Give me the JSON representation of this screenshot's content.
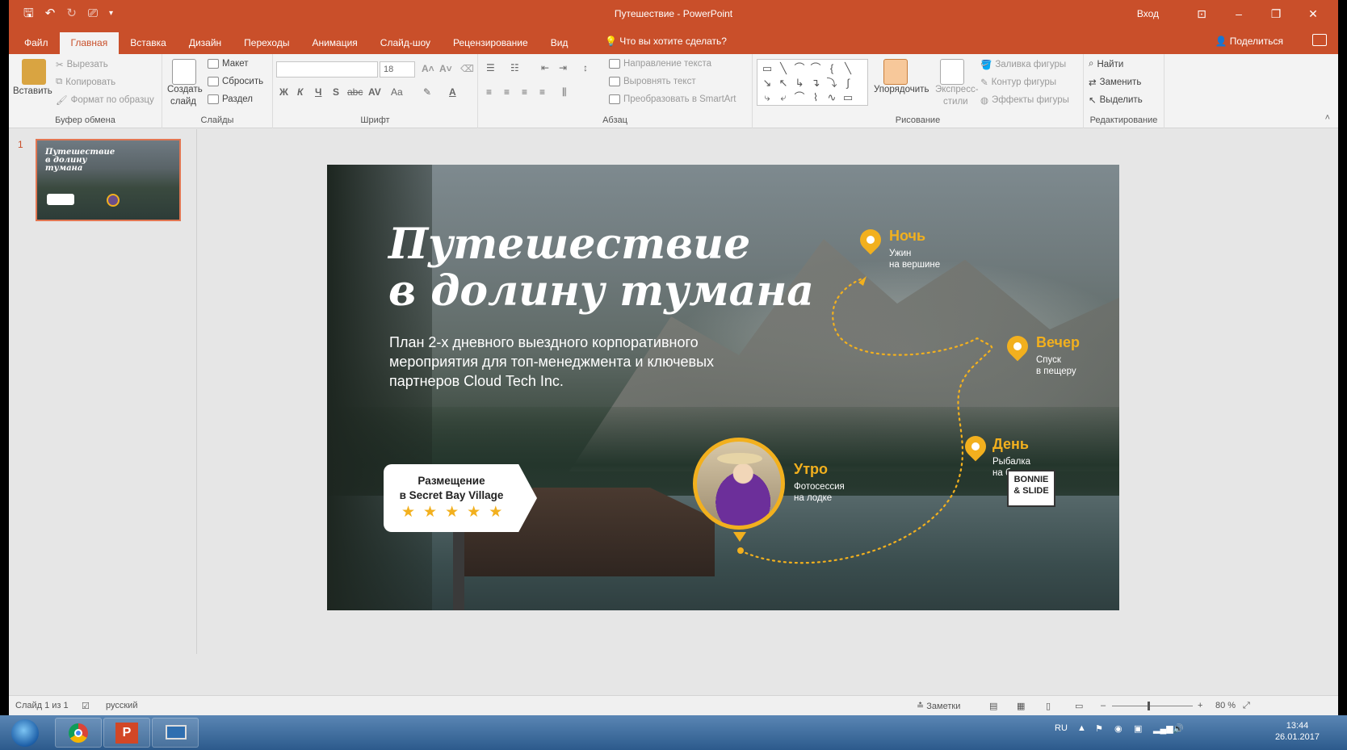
{
  "window": {
    "title": "Путешествие - PowerPoint",
    "signin": "Вход",
    "qat_icons": [
      "save-icon",
      "undo-icon",
      "redo-icon",
      "present-icon",
      "customize-icon"
    ]
  },
  "tabs": [
    "Файл",
    "Главная",
    "Вставка",
    "Дизайн",
    "Переходы",
    "Анимация",
    "Слайд-шоу",
    "Рецензирование",
    "Вид"
  ],
  "active_tab": "Главная",
  "tell_me": "Что вы хотите сделать?",
  "share": "Поделиться",
  "ribbon": {
    "clipboard": {
      "paste": "Вставить",
      "cut": "Вырезать",
      "copy": "Копировать",
      "format_painter": "Формат по образцу",
      "label": "Буфер обмена"
    },
    "slides": {
      "new_slide_1": "Создать",
      "new_slide_2": "слайд",
      "layout": "Макет",
      "reset": "Сбросить",
      "section": "Раздел",
      "label": "Слайды"
    },
    "font": {
      "font_name": "",
      "font_size": "18",
      "label": "Шрифт",
      "bold": "Ж",
      "italic": "К",
      "underline": "Ч",
      "shadow": "S",
      "strike": "abc",
      "spacing": "AV",
      "case": "Aa"
    },
    "paragraph": {
      "text_direction": "Направление текста",
      "align_text": "Выровнять текст",
      "smartart": "Преобразовать в SmartArt",
      "label": "Абзац"
    },
    "drawing": {
      "arrange": "Упорядочить",
      "quick_styles_1": "Экспресс-",
      "quick_styles_2": "стили",
      "shape_fill": "Заливка фигуры",
      "shape_outline": "Контур фигуры",
      "shape_effects": "Эффекты фигуры",
      "label": "Рисование"
    },
    "editing": {
      "find": "Найти",
      "replace": "Заменить",
      "select": "Выделить",
      "label": "Редактирование"
    }
  },
  "thumbnail": {
    "number": "1"
  },
  "slide": {
    "title_line1": "Путешествие",
    "title_line2": "в долину тумана",
    "subtitle": "План 2-х дневного выездного корпоративного мероприятия для топ-менеджмента и ключевых партнеров Cloud Tech Inc.",
    "accommodation_line1": "Размещение",
    "accommodation_line2": "в Secret Bay Village",
    "stars": 5,
    "points": [
      {
        "title": "Утро",
        "desc1": "Фотосессия",
        "desc2": "на лодке"
      },
      {
        "title": "День",
        "desc1": "Рыбалка",
        "desc2": "на берегу"
      },
      {
        "title": "Вечер",
        "desc1": "Спуск",
        "desc2": "в пещеру"
      },
      {
        "title": "Ночь",
        "desc1": "Ужин",
        "desc2": "на вершине"
      }
    ],
    "accent_color": "#f2b01e",
    "logo_line1": "BONNIE",
    "logo_line2": "& SLIDE"
  },
  "status": {
    "slide_counter": "Слайд 1 из 1",
    "language": "русский",
    "notes": "Заметки",
    "zoom": "80 %"
  },
  "taskbar": {
    "lang": "RU",
    "time": "13:44",
    "date": "26.01.2017"
  },
  "colors": {
    "brand": "#c94f2a",
    "ribbon": "#f3f3f3"
  }
}
